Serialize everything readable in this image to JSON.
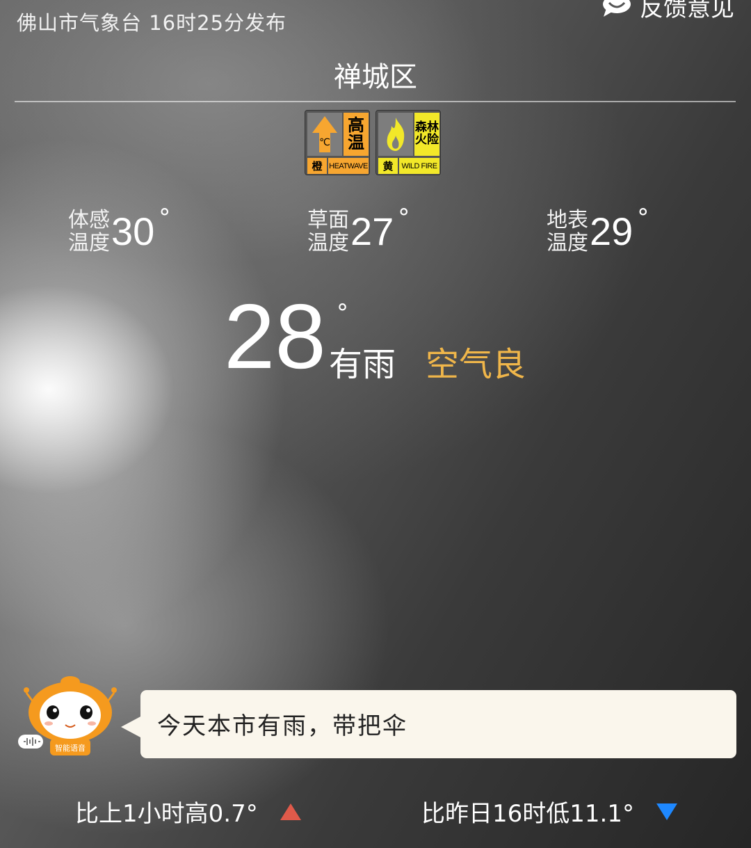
{
  "header": {
    "publish_text": "佛山市气象台 16时25分发布",
    "feedback_label": "反馈意见",
    "feedback_icon": "feedback-icon"
  },
  "location": {
    "name": "禅城区"
  },
  "warnings": [
    {
      "icon": "heatwave-warning-icon",
      "title_line1": "高",
      "title_line2": "温",
      "symbol": "℃",
      "level": "橙",
      "english": "HEATWAVE",
      "color": "#f7a630"
    },
    {
      "icon": "wildfire-warning-icon",
      "title_line1": "森林",
      "title_line2": "火险",
      "level": "黄",
      "english": "WILD FIRE",
      "color": "#f2e829"
    }
  ],
  "metrics": [
    {
      "label_line1": "体感",
      "label_line2": "温度",
      "value": "30",
      "unit": "°"
    },
    {
      "label_line1": "草面",
      "label_line2": "温度",
      "value": "27",
      "unit": "°"
    },
    {
      "label_line1": "地表",
      "label_line2": "温度",
      "value": "29",
      "unit": "°"
    }
  ],
  "current": {
    "temperature": "28",
    "unit": "°",
    "weather": "有雨",
    "air_quality": "空气良",
    "air_quality_color": "#f0b64a"
  },
  "assistant": {
    "icon": "robot-assistant-icon",
    "label": "智能语音",
    "message": "今天本市有雨，带把伞"
  },
  "comparisons": {
    "hourly": {
      "text": "比上1小时高0.7°",
      "arrow": "up-arrow-icon",
      "arrow_color": "#e05a4a"
    },
    "yesterday": {
      "text": "比昨日16时低11.1°",
      "arrow": "down-arrow-icon",
      "arrow_color": "#1e88ff"
    }
  }
}
